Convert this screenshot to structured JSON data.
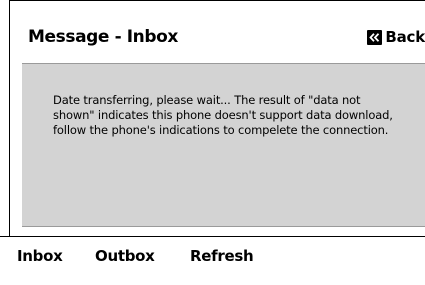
{
  "header": {
    "title": "Message - Inbox",
    "back_label": "Back",
    "back_icon": "double-chevron-left-icon"
  },
  "message": {
    "text": "Date transferring, please wait... The result of \"data not shown\" indicates this phone doesn't support data download, follow the phone's indications to compelete the connection."
  },
  "tabs": [
    {
      "label": "Inbox"
    },
    {
      "label": "Outbox"
    },
    {
      "label": "Refresh"
    }
  ],
  "colors": {
    "panel_background": "#d3d3d3",
    "text": "#000000",
    "background": "#ffffff"
  }
}
